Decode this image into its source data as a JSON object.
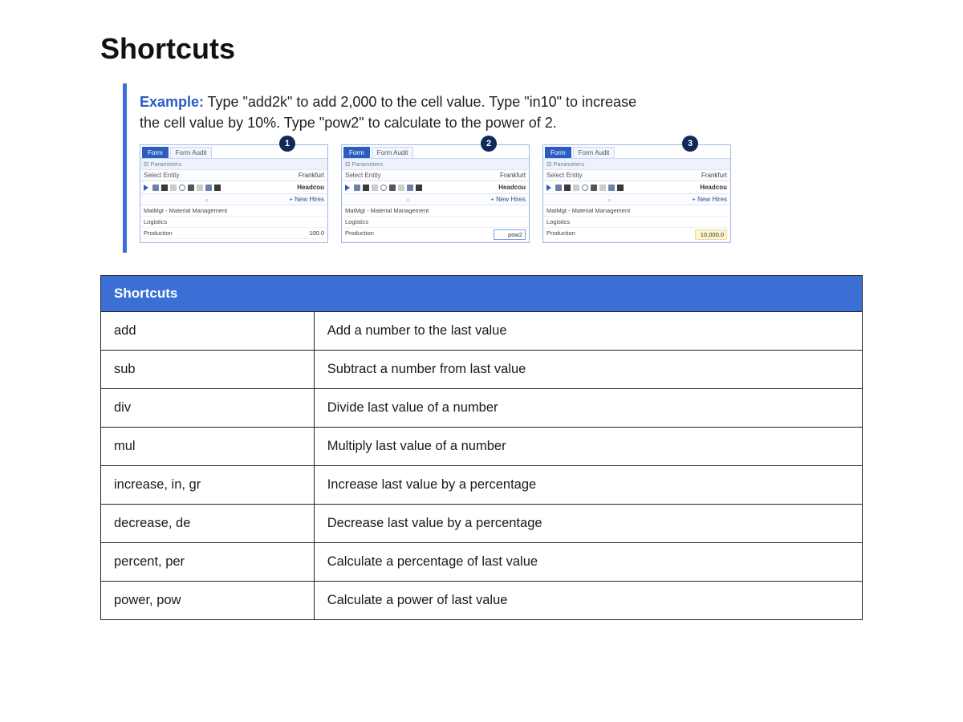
{
  "title": "Shortcuts",
  "example": {
    "label": "Example:",
    "text": "Type \"add2k\" to add 2,000 to the cell value. Type \"in10\" to increase the cell value by 10%. Type \"pow2\" to calculate to the power of 2."
  },
  "screens": [
    {
      "badge": "1",
      "tab_active": "Form",
      "tab_inactive": "Form Audit",
      "param_hdr": "Parameters",
      "select_label": "Select Entity",
      "select_value": "Frankfurt",
      "head_label": "Headcou",
      "new_hires": "+  New Hires",
      "rows": [
        {
          "label": "MatMgt - Material Management",
          "value": ""
        },
        {
          "label": "Logistics",
          "value": ""
        },
        {
          "label": "Production",
          "value": "100.0",
          "cls": ""
        }
      ]
    },
    {
      "badge": "2",
      "tab_active": "Form",
      "tab_inactive": "Form Audit",
      "param_hdr": "Parameters",
      "select_label": "Select Entity",
      "select_value": "Frankfurt",
      "head_label": "Headcou",
      "new_hires": "+  New Hires",
      "rows": [
        {
          "label": "MatMgt - Material Management",
          "value": ""
        },
        {
          "label": "Logistics",
          "value": ""
        },
        {
          "label": "Production",
          "value": "pow2",
          "cls": "inp"
        }
      ]
    },
    {
      "badge": "3",
      "tab_active": "Form",
      "tab_inactive": "Form Audit",
      "param_hdr": "Parameters",
      "select_label": "Select Entity",
      "select_value": "Frankfurt",
      "head_label": "Headcou",
      "new_hires": "+  New Hires",
      "rows": [
        {
          "label": "MatMgt - Material Management",
          "value": ""
        },
        {
          "label": "Logistics",
          "value": ""
        },
        {
          "label": "Production",
          "value": "10,000.0",
          "cls": "hl"
        }
      ]
    }
  ],
  "table": {
    "header": "Shortcuts",
    "rows": [
      {
        "key": "add",
        "desc": "Add a number to the last value"
      },
      {
        "key": "sub",
        "desc": "Subtract a number from last value"
      },
      {
        "key": "div",
        "desc": "Divide last value of a number"
      },
      {
        "key": "mul",
        "desc": "Multiply last value of a number"
      },
      {
        "key": "increase, in, gr",
        "desc": "Increase last value by a percentage"
      },
      {
        "key": "decrease, de",
        "desc": "Decrease last value by a percentage"
      },
      {
        "key": "percent, per",
        "desc": "Calculate a percentage of last value"
      },
      {
        "key": "power, pow",
        "desc": "Calculate a power of last value"
      }
    ]
  }
}
